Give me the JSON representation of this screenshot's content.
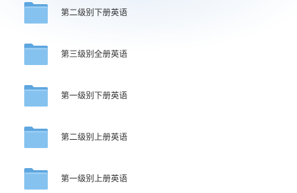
{
  "files": [
    {
      "name": "第二级别下册英语",
      "icon": "folder-icon"
    },
    {
      "name": "第三级别全册英语",
      "icon": "folder-icon"
    },
    {
      "name": "第一级别下册英语",
      "icon": "folder-icon"
    },
    {
      "name": "第二级别上册英语",
      "icon": "folder-icon"
    },
    {
      "name": "第一级别上册英语",
      "icon": "folder-icon"
    }
  ],
  "colors": {
    "folder_back": "#5ea6df",
    "folder_front": "#86c2ef",
    "folder_highlight": "#a9d5f5",
    "text": "#333333"
  }
}
